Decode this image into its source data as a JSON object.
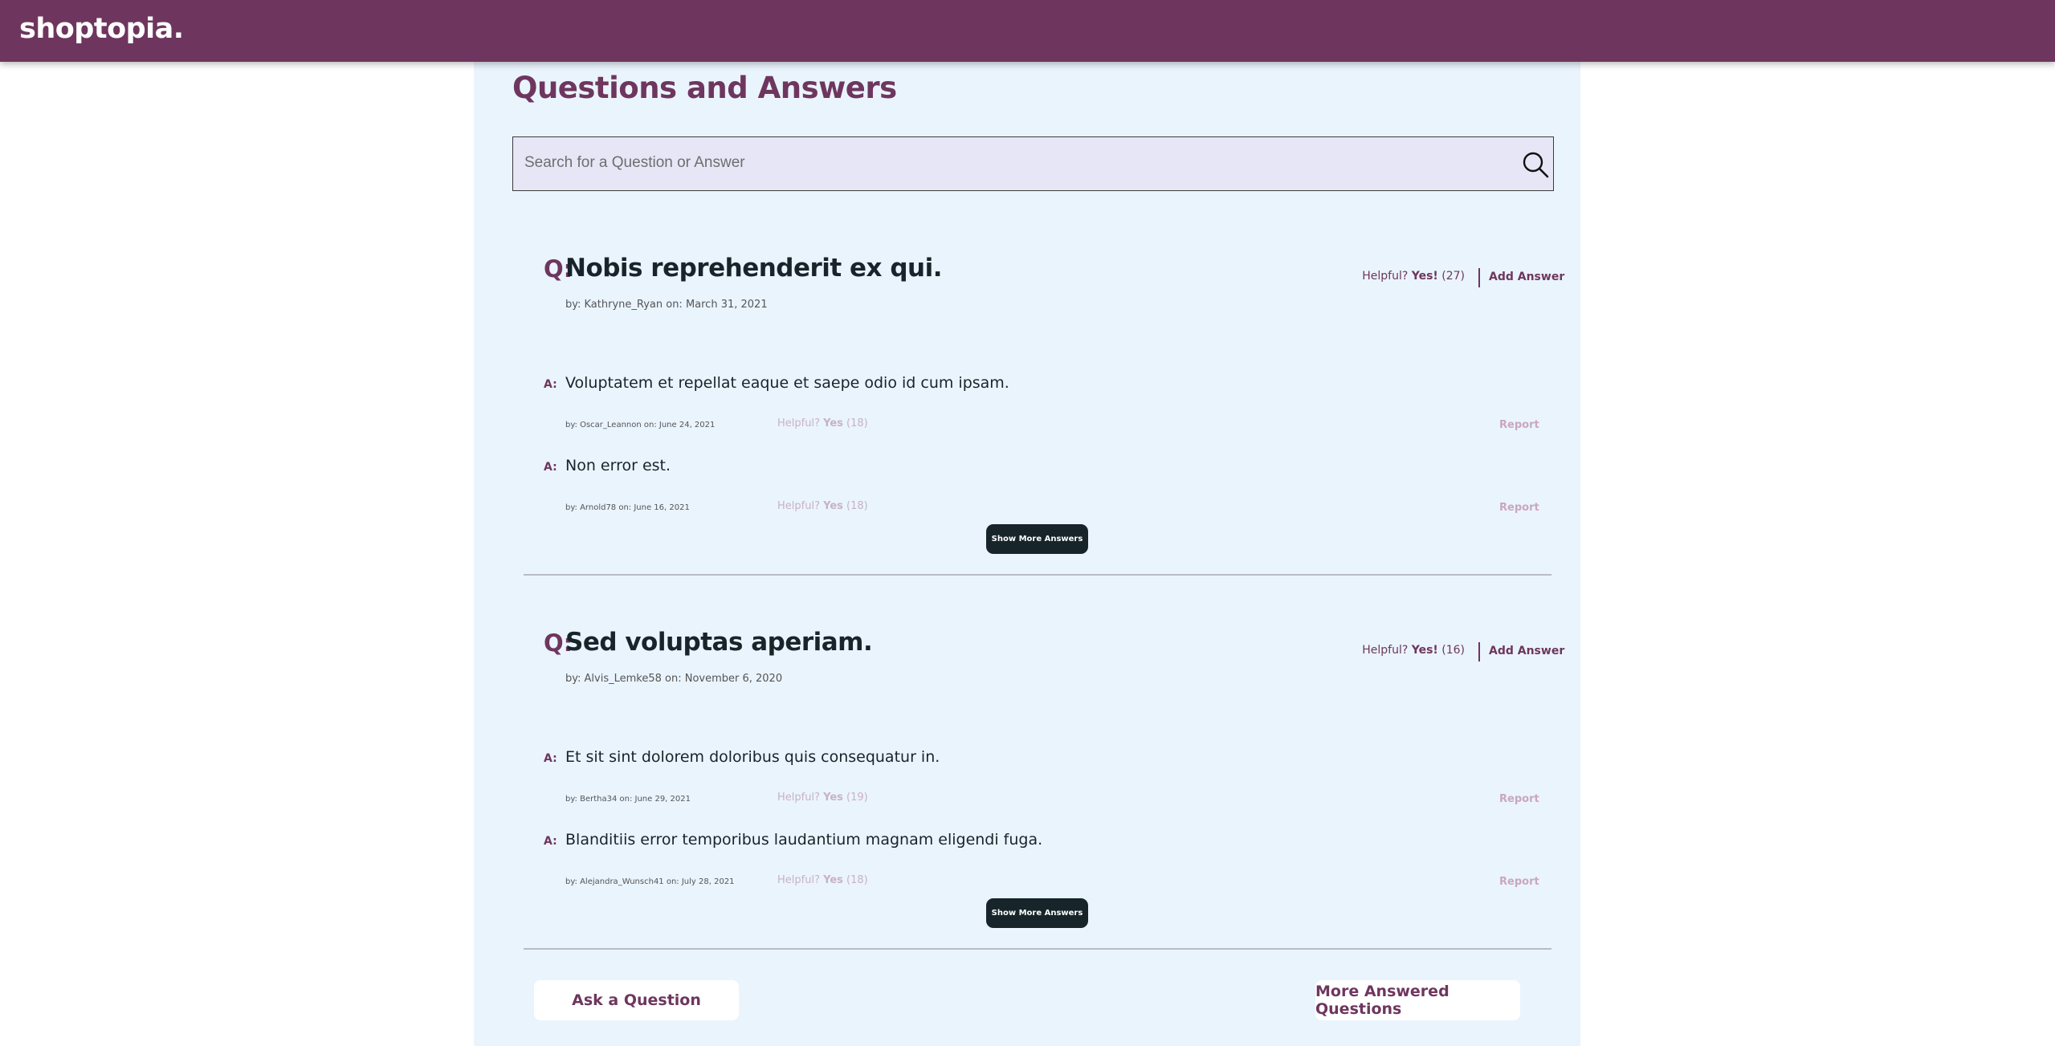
{
  "app": {
    "brand": "shoptopia."
  },
  "qa": {
    "title": "Questions and Answers",
    "search": {
      "placeholder": "Search for a Question or Answer",
      "value": ""
    },
    "questions": [
      {
        "prefix": "Q:",
        "text": "Nobis reprehenderit ex qui.",
        "meta": "by: Kathryne_Ryan on: March 31, 2021",
        "helpful_label": "Helpful?",
        "yes_label": "Yes!",
        "helpful_count": "(27)",
        "add_answer_label": "Add Answer",
        "answers": [
          {
            "prefix": "A:",
            "text": "Voluptatem et repellat eaque et saepe odio id cum ipsam.",
            "meta": "by: Oscar_Leannon on: June 24, 2021",
            "helpful_label": "Helpful?",
            "yes_label": "Yes",
            "helpful_count": "(18)",
            "report_label": "Report"
          },
          {
            "prefix": "A:",
            "text": "Non error est.",
            "meta": "by: Arnold78 on: June 16, 2021",
            "helpful_label": "Helpful?",
            "yes_label": "Yes",
            "helpful_count": "(18)",
            "report_label": "Report"
          }
        ],
        "show_more_label": "Show More Answers"
      },
      {
        "prefix": "Q:",
        "text": "Sed voluptas aperiam.",
        "meta": "by: Alvis_Lemke58 on: November 6, 2020",
        "helpful_label": "Helpful?",
        "yes_label": "Yes!",
        "helpful_count": "(16)",
        "add_answer_label": "Add Answer",
        "answers": [
          {
            "prefix": "A:",
            "text": "Et sit sint dolorem doloribus quis consequatur in.",
            "meta": "by: Bertha34 on: June 29, 2021",
            "helpful_label": "Helpful?",
            "yes_label": "Yes",
            "helpful_count": "(19)",
            "report_label": "Report"
          },
          {
            "prefix": "A:",
            "text": "Blanditiis error temporibus laudantium magnam eligendi fuga.",
            "meta": "by: Alejandra_Wunsch41 on: July 28, 2021",
            "helpful_label": "Helpful?",
            "yes_label": "Yes",
            "helpful_count": "(18)",
            "report_label": "Report"
          }
        ],
        "show_more_label": "Show More Answers"
      }
    ],
    "ask_question_label": "Ask a Question",
    "more_questions_label": "More Answered Questions"
  },
  "colors": {
    "header": "#6e365e",
    "panel": "#eaf4fd",
    "accent": "#6e365e",
    "dark_button": "#17252a",
    "search_bg": "#e6e6f6"
  },
  "icons": {
    "search": "search-icon"
  }
}
